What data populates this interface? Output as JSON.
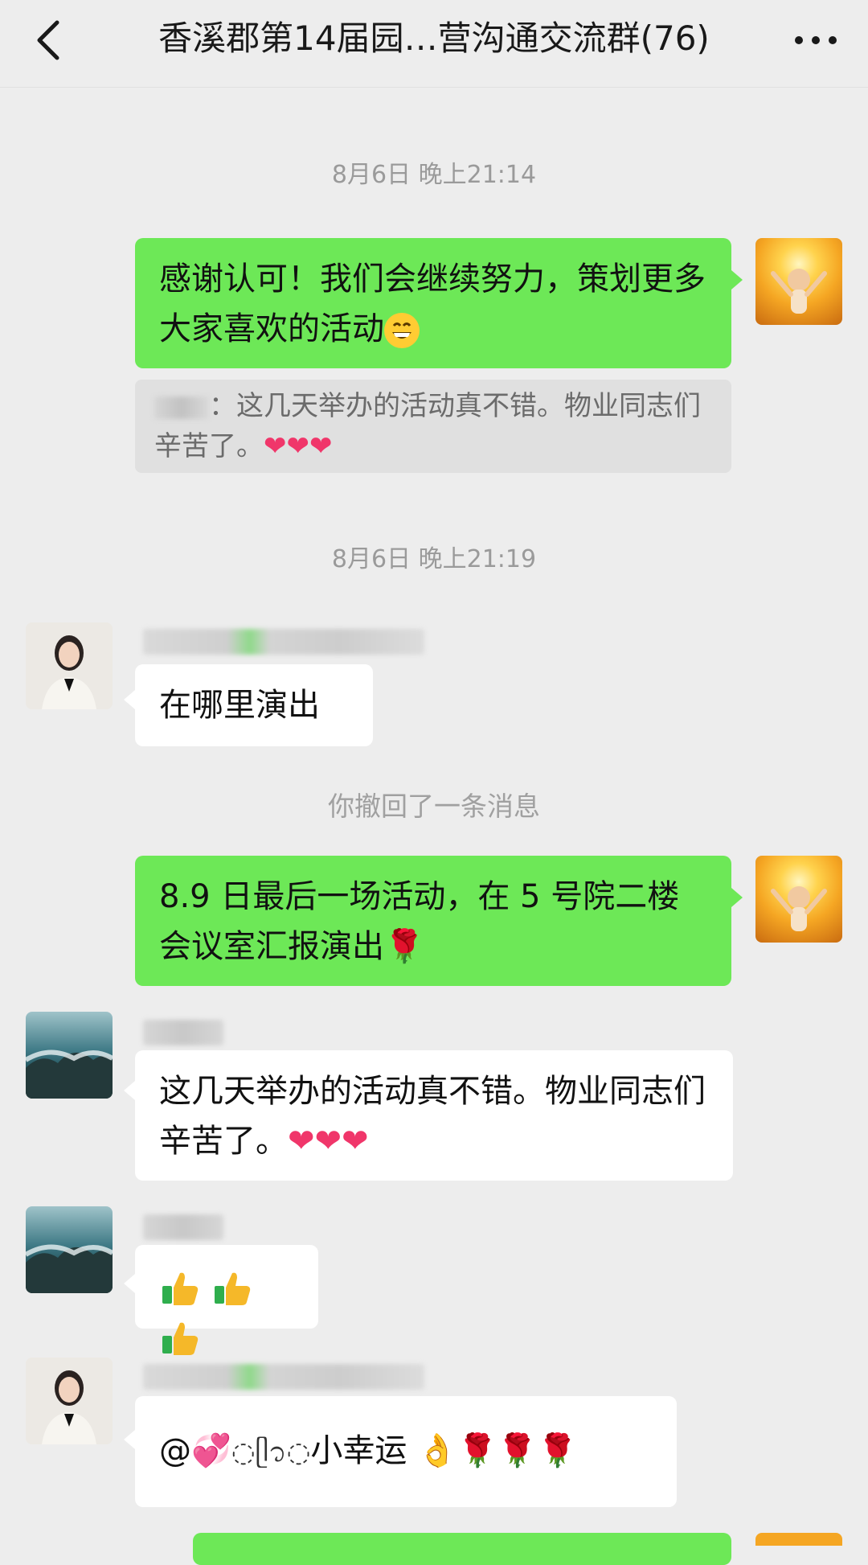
{
  "header": {
    "back_icon": "chevron-left-icon",
    "title": "香溪郡第14届园…营沟通交流群(76)",
    "more_icon": "more-dots-icon"
  },
  "colors": {
    "background": "#ededed",
    "self_bubble": "#6de857",
    "other_bubble": "#ffffff",
    "timestamp": "#9a9a9a"
  },
  "timestamps": {
    "first": "8月6日 晚上21:14",
    "second": "8月6日 晚上21:19"
  },
  "messages": {
    "m1_text": "感谢认可！我们会继续努力，策划更多大家喜欢的活动",
    "m1_quote_prefix": "：",
    "m1_quote_text": "这几天举办的活动真不错。物业同志们辛苦了。",
    "m2_text": "在哪里演出",
    "recalled": "你撤回了一条消息",
    "m3_text": "8.9 日最后一场活动，在 5 号院二楼会议室汇报演出",
    "m4_text": "这几天举办的活动真不错。物业同志们辛苦了。",
    "m6_mention": "@",
    "m6_name": "小幸运",
    "m6_suffix": "👌🌹🌹🌹"
  }
}
